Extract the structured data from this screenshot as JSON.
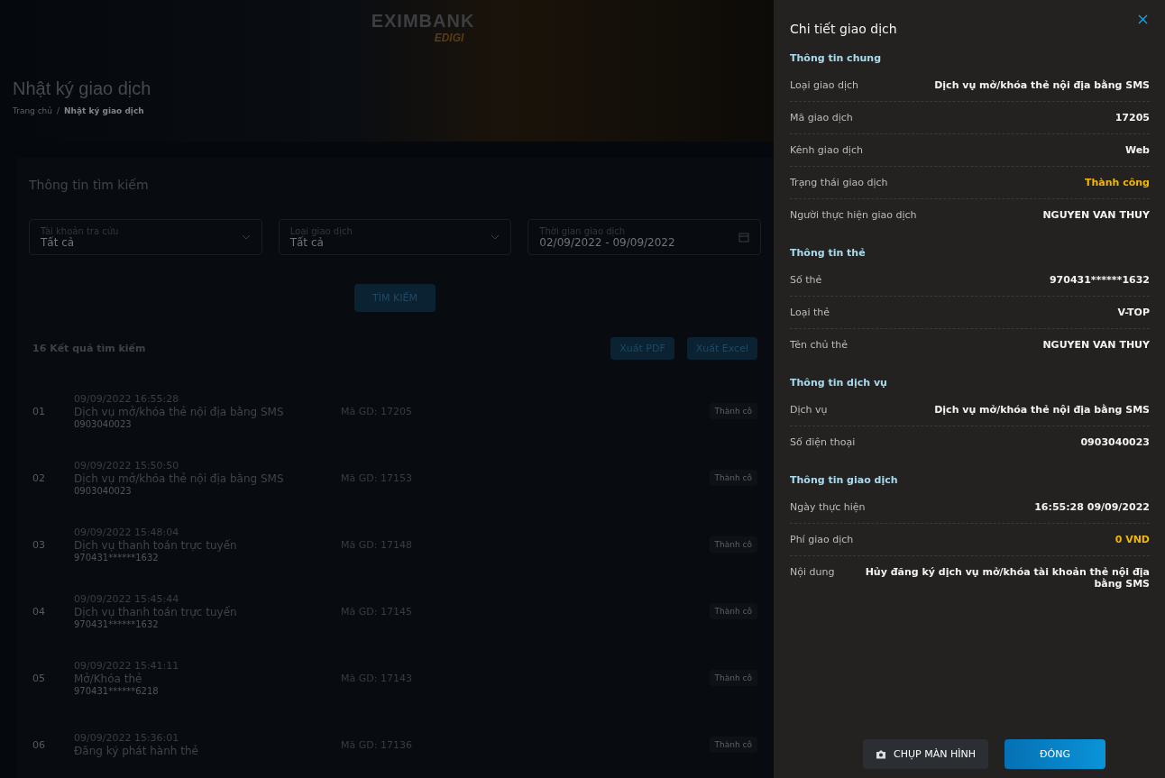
{
  "page": {
    "logo": {
      "name": "EXIMBANK",
      "sub": "EDIGI"
    },
    "title": "Nhật ký giao dịch",
    "breadcrumb_separator": "/",
    "breadcrumb": [
      {
        "label": "Trang chủ",
        "selected": false
      },
      {
        "label": "Nhật ký giao dịch",
        "selected": true
      }
    ],
    "search": {
      "title": "Thông tin tìm kiếm",
      "fields": [
        {
          "kind": "select",
          "label": "Tài khoản tra cứu",
          "value": "Tất cả"
        },
        {
          "kind": "select",
          "label": "Loại giao dịch",
          "value": "Tất cả"
        },
        {
          "kind": "date",
          "label": "Thời gian giao dịch",
          "value": "02/09/2022 - 09/09/2022"
        }
      ],
      "button": "TÌM KIẾM"
    },
    "results": {
      "count": "16 Kết quả tìm kiếm",
      "actions": [
        "Xuất PDF",
        "Xuất Excel"
      ],
      "rows": [
        {
          "index": "01",
          "time": "09/09/2022 16:55:28",
          "title": "Dịch vụ mở/khóa thẻ nội địa bằng SMS",
          "sub": "0903040023",
          "code": "Mã GD: 17205",
          "status": "Thành cô"
        },
        {
          "index": "02",
          "time": "09/09/2022 15:50:50",
          "title": "Dịch vụ mở/khóa thẻ nội địa bằng SMS",
          "sub": "0903040023",
          "code": "Mã GD: 17153",
          "status": "Thành cô"
        },
        {
          "index": "03",
          "time": "09/09/2022 15:48:04",
          "title": "Dịch vụ thanh toán trực tuyến",
          "sub": "970431******1632",
          "code": "Mã GD: 17148",
          "status": "Thành cô"
        },
        {
          "index": "04",
          "time": "09/09/2022 15:45:44",
          "title": "Dịch vụ thanh toán trực tuyến",
          "sub": "970431******1632",
          "code": "Mã GD: 17145",
          "status": "Thành cô"
        },
        {
          "index": "05",
          "time": "09/09/2022 15:41:11",
          "title": "Mở/Khóa thẻ",
          "sub": "970431******6218",
          "code": "Mã GD: 17143",
          "status": "Thành cô"
        },
        {
          "index": "06",
          "time": "09/09/2022 15:36:01",
          "title": "Đăng ký phát hành thẻ",
          "code": "Mã GD: 17136",
          "status": "Thành cô"
        }
      ]
    }
  },
  "drawer": {
    "title": "Chi tiết giao dịch",
    "sections": [
      {
        "heading": "Thông tin chung",
        "rows": [
          {
            "label": "Loại giao dịch",
            "value": "Dịch vụ mở/khóa thẻ nội địa bằng SMS",
            "highlighted": false
          },
          {
            "label": "Mã giao dịch",
            "value": "17205",
            "highlighted": false
          },
          {
            "label": "Kênh giao dịch",
            "value": "Web",
            "highlighted": false
          },
          {
            "label": "Trạng thái giao dịch",
            "value": "Thành công",
            "highlighted": true
          },
          {
            "label": "Người thực hiện giao dịch",
            "value": "NGUYEN VAN THUY",
            "highlighted": false
          }
        ]
      },
      {
        "heading": "Thông tin thẻ",
        "rows": [
          {
            "label": "Số thẻ",
            "value": "970431******1632",
            "highlighted": false
          },
          {
            "label": "Loại thẻ",
            "value": "V-TOP",
            "highlighted": false
          },
          {
            "label": "Tên chủ thẻ",
            "value": "NGUYEN VAN THUY",
            "highlighted": false
          }
        ]
      },
      {
        "heading": "Thông tin dịch vụ",
        "rows": [
          {
            "label": "Dịch vụ",
            "value": "Dịch vụ mở/khóa thẻ nội địa bằng SMS",
            "highlighted": false
          },
          {
            "label": "Số điện thoại",
            "value": "0903040023",
            "highlighted": false
          }
        ]
      },
      {
        "heading": "Thông tin giao dịch",
        "rows": [
          {
            "label": "Ngày thực hiện",
            "value": "16:55:28 09/09/2022",
            "highlighted": false
          },
          {
            "label": "Phí giao dịch",
            "value": "0 VND",
            "highlighted": true
          },
          {
            "label": "Nội dung",
            "value": "Hủy đăng ký dịch vụ mở/khóa tài khoản thẻ nội địa bằng SMS",
            "highlighted": false
          }
        ]
      }
    ],
    "buttons": [
      {
        "kind": "secondary",
        "label": "CHỤP MÀN HÌNH"
      },
      {
        "kind": "primary",
        "label": "ĐÓNG"
      }
    ]
  }
}
